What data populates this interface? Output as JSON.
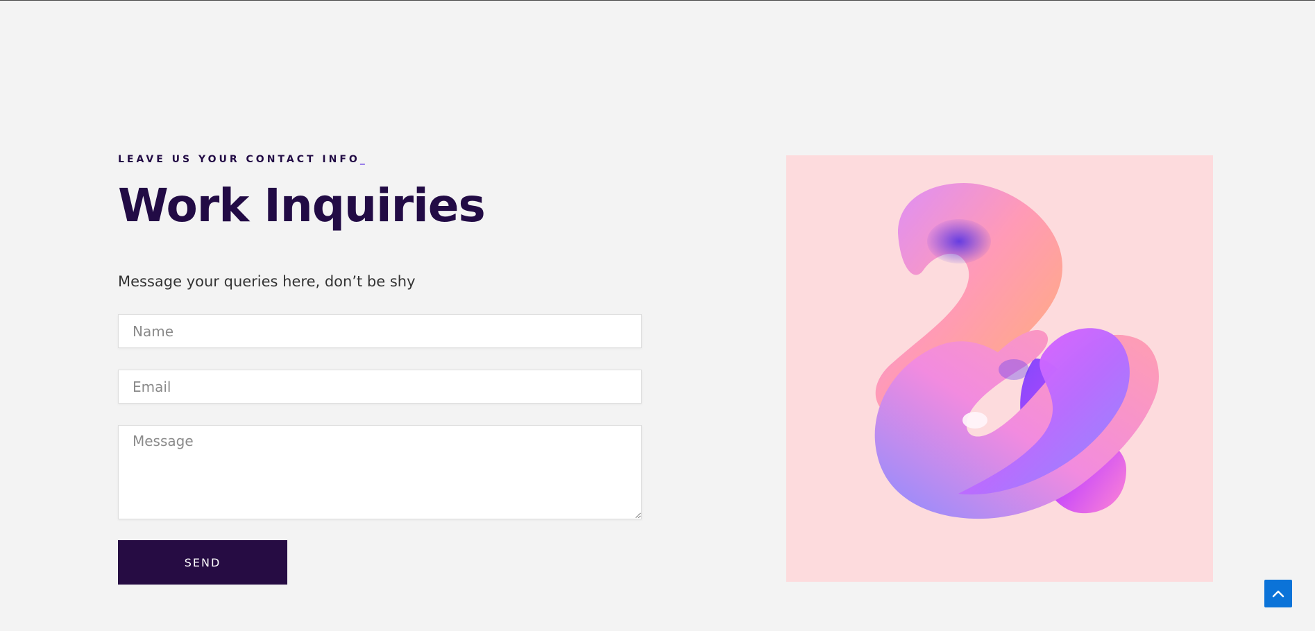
{
  "contact": {
    "eyebrow": "LEAVE US YOUR CONTACT INFO",
    "eyebrow_suffix": "_",
    "title": "Work Inquiries",
    "subtitle": "Message your queries here, don’t be shy",
    "form": {
      "name_placeholder": "Name",
      "email_placeholder": "Email",
      "message_placeholder": "Message",
      "submit_label": "SEND"
    }
  },
  "image": {
    "name": "ampersand-3d-art",
    "background_color": "#fddbdd"
  },
  "scroll_top": {
    "icon": "chevron-up-icon",
    "color": "#0b73d8"
  },
  "colors": {
    "heading": "#220b45",
    "button": "#260c43",
    "page_background": "#f3f3f3"
  }
}
